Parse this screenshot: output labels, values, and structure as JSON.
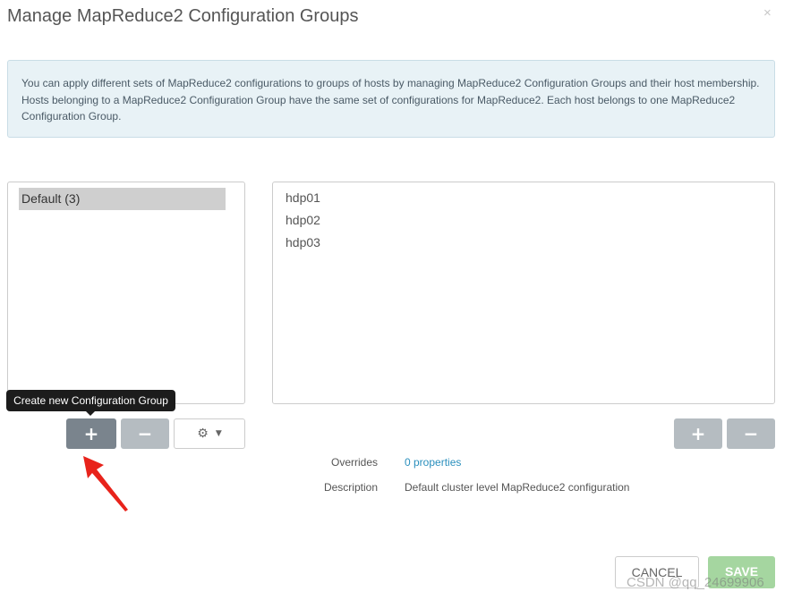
{
  "modal": {
    "title": "Manage MapReduce2 Configuration Groups",
    "close_glyph": "×"
  },
  "info": {
    "text": "You can apply different sets of MapReduce2 configurations to groups of hosts by managing MapReduce2 Configuration Groups and their host membership. Hosts belonging to a MapReduce2 Configuration Group have the same set of configurations for MapReduce2. Each host belongs to one MapReduce2 Configuration Group."
  },
  "groups": {
    "items": [
      {
        "label": "Default (3)",
        "selected": true
      }
    ]
  },
  "hosts": {
    "items": [
      "hdp01",
      "hdp02",
      "hdp03"
    ]
  },
  "buttons": {
    "add_glyph": "+",
    "remove_glyph": "−",
    "gear_icon": "gear-icon",
    "gear_glyph": "⚙",
    "caret_glyph": "▼",
    "cancel_label": "CANCEL",
    "save_label": "SAVE"
  },
  "tooltip": {
    "text": "Create new Configuration Group"
  },
  "details": {
    "overrides_label": "Overrides",
    "overrides_value": "0 properties",
    "description_label": "Description",
    "description_value": "Default cluster level MapReduce2 configuration"
  },
  "watermark": "CSDN @qq_24699906",
  "colors": {
    "accent_link": "#2a8fbd",
    "save_disabled": "#a5d6a0",
    "primary_button": "#7a848d",
    "annotation_arrow": "#e8231b"
  }
}
